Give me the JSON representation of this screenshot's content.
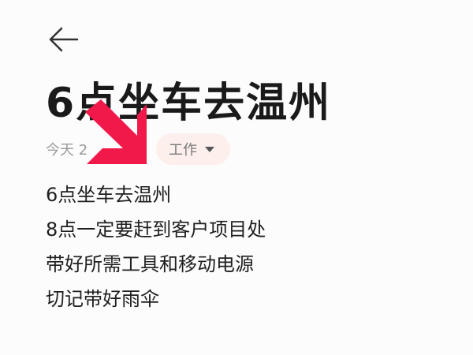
{
  "header": {
    "back_icon": "back-arrow-icon"
  },
  "note": {
    "title": "6点坐车去温州",
    "date": "今天 2",
    "category": {
      "label": "工作",
      "icon": "chevron-down-icon",
      "background": "#fcefec"
    },
    "lines": [
      "6点坐车去温州",
      "8点一定要赶到客户项目处",
      "带好所需工具和移动电源",
      "切记带好雨伞"
    ]
  },
  "overlay": {
    "icon": "pointer-arrow-icon",
    "color": "#f0194a"
  }
}
